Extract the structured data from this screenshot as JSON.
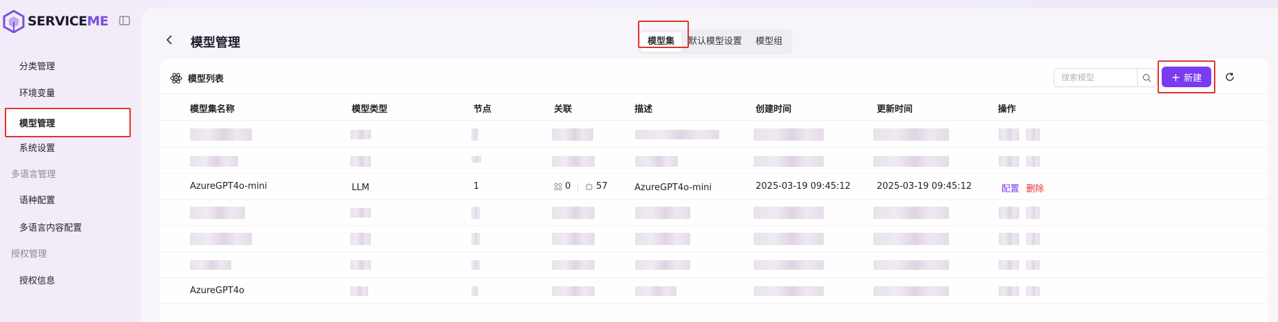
{
  "app": {
    "logo_text": "SERVICE",
    "logo_suffix": "ME"
  },
  "sidebar": {
    "items": [
      {
        "label": "分类管理"
      },
      {
        "label": "环境变量"
      },
      {
        "label": "模型管理"
      },
      {
        "label": "系统设置"
      }
    ],
    "group_lang": "多语言管理",
    "lang_items": [
      {
        "label": "语种配置"
      },
      {
        "label": "多语言内容配置"
      }
    ],
    "group_auth": "授权管理",
    "auth_items": [
      {
        "label": "授权信息"
      }
    ]
  },
  "header": {
    "title": "模型管理",
    "tabs": [
      {
        "label": "模型集"
      },
      {
        "label": "默认模型设置"
      },
      {
        "label": "模型组"
      }
    ]
  },
  "card": {
    "title": "模型列表",
    "search_placeholder": "搜索模型",
    "new_label": "新建"
  },
  "table": {
    "columns": [
      "模型集名称",
      "模型类型",
      "节点",
      "关联",
      "描述",
      "创建时间",
      "更新时间",
      "操作"
    ],
    "visible_row": {
      "name": "AzureGPT4o-mini",
      "type": "LLM",
      "nodes": "1",
      "rel_a": "0",
      "rel_b": "57",
      "desc": "AzureGPT4o-mini",
      "created": "2025-03-19 09:45:12",
      "updated": "2025-03-19 09:45:12",
      "action_config": "配置",
      "action_delete": "删除"
    },
    "partial_row": {
      "name": "AzureGPT4o"
    }
  },
  "colors": {
    "accent": "#7a3cf0",
    "danger": "#e0322f"
  }
}
